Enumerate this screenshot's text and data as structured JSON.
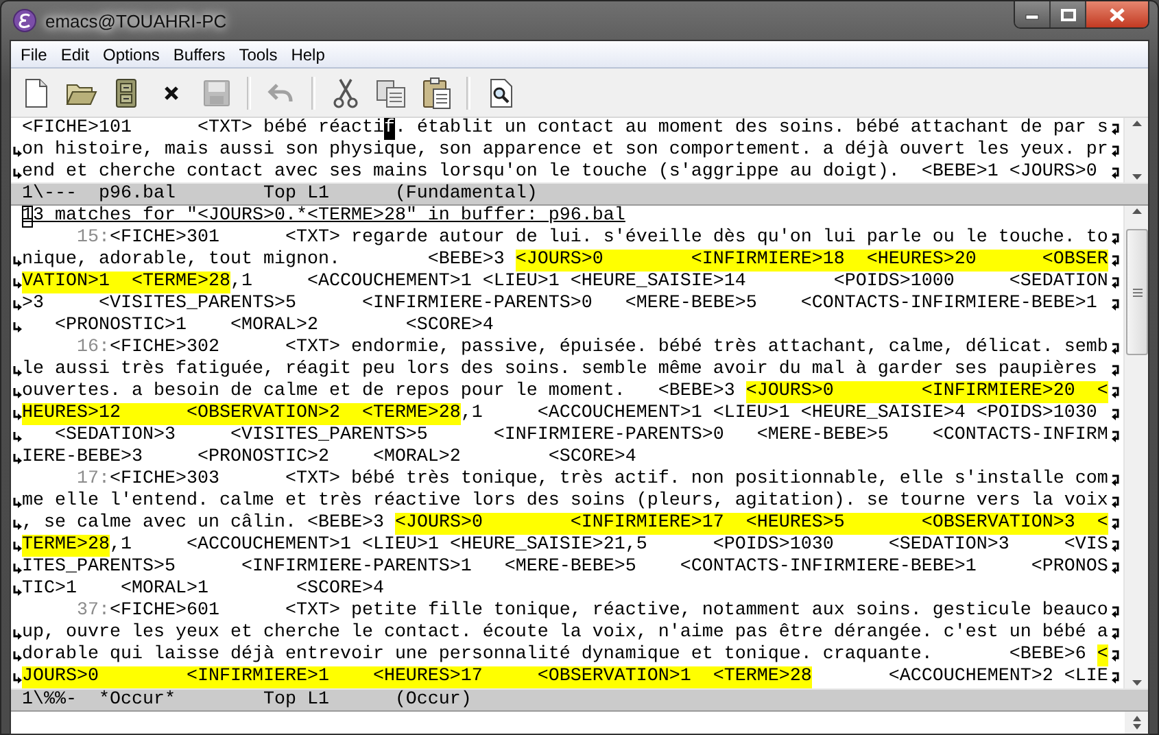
{
  "window": {
    "title": "emacs@TOUAHRI-PC"
  },
  "menu": [
    "File",
    "Edit",
    "Options",
    "Buffers",
    "Tools",
    "Help"
  ],
  "toolbar": [
    {
      "kind": "new",
      "disabled": false
    },
    {
      "kind": "open",
      "disabled": false
    },
    {
      "kind": "dired",
      "disabled": false
    },
    {
      "kind": "kill",
      "disabled": false
    },
    {
      "kind": "save",
      "disabled": true
    },
    {
      "kind": "separator"
    },
    {
      "kind": "undo",
      "disabled": true
    },
    {
      "kind": "separator"
    },
    {
      "kind": "cut",
      "disabled": false
    },
    {
      "kind": "copy",
      "disabled": false
    },
    {
      "kind": "paste",
      "disabled": false
    },
    {
      "kind": "separator"
    },
    {
      "kind": "search",
      "disabled": false
    }
  ],
  "buffers": [
    {
      "lines": [
        {
          "segments": [
            {
              "kind": "text",
              "text": "<FICHE>101      <TXT> bébé réacti"
            },
            {
              "kind": "cursor",
              "text": "f"
            },
            {
              "kind": "text",
              "text": ". établit un contact au moment des soins. bébé attachant de par s"
            }
          ],
          "wrap_start": false,
          "wrap_end": true
        },
        {
          "segments": [
            {
              "kind": "text",
              "text": "on histoire, mais aussi son physique, son apparence et son comportement. a déjà ouvert les yeux. pr"
            }
          ],
          "wrap_start": true,
          "wrap_end": true
        },
        {
          "segments": [
            {
              "kind": "text",
              "text": "end et cherche contact avec ses mains lorsqu'on le touche (s'aggrippe au doigt).  <BEBE>1 <JOURS>0"
            }
          ],
          "wrap_start": true,
          "wrap_end": true
        }
      ],
      "mode_line": "1\\---  p96.bal        Top L1      (Fundamental)"
    },
    {
      "lines": [
        {
          "segments": [
            {
              "kind": "cursor-hollow",
              "text": "1"
            },
            {
              "kind": "header",
              "text": "3 matches for \"<JOURS>0.*<TERME>28\" in buffer: p96.bal"
            }
          ],
          "wrap_start": false,
          "wrap_end": false
        },
        {
          "segments": [
            {
              "kind": "line-number",
              "text": "     15:"
            },
            {
              "kind": "text",
              "text": "<FICHE>301      <TXT> regarde autour de lui. s'éveille dès qu'on lui parle ou le touche. to"
            }
          ],
          "wrap_start": false,
          "wrap_end": true
        },
        {
          "segments": [
            {
              "kind": "text",
              "text": "nique, adorable, tout mignon.        <BEBE>3 "
            },
            {
              "kind": "match",
              "text": "<JOURS>0        <INFIRMIERE>18  <HEURES>20      <OBSER"
            }
          ],
          "wrap_start": true,
          "wrap_end": true
        },
        {
          "segments": [
            {
              "kind": "match",
              "text": "VATION>1  <TERME>28"
            },
            {
              "kind": "text",
              "text": ",1     <ACCOUCHEMENT>1 <LIEU>1 <HEURE_SAISIE>14        <POIDS>1000     <SEDATION"
            }
          ],
          "wrap_start": true,
          "wrap_end": true
        },
        {
          "segments": [
            {
              "kind": "text",
              "text": ">3     <VISITES_PARENTS>5      <INFIRMIERE-PARENTS>0   <MERE-BEBE>5    <CONTACTS-INFIRMIERE-BEBE>1"
            }
          ],
          "wrap_start": true,
          "wrap_end": true
        },
        {
          "segments": [
            {
              "kind": "text",
              "text": "   <PRONOSTIC>1    <MORAL>2        <SCORE>4"
            }
          ],
          "wrap_start": true,
          "wrap_end": false
        },
        {
          "segments": [
            {
              "kind": "line-number",
              "text": "     16:"
            },
            {
              "kind": "text",
              "text": "<FICHE>302      <TXT> endormie, passive, épuisée. bébé très attachant, calme, délicat. semb"
            }
          ],
          "wrap_start": false,
          "wrap_end": true
        },
        {
          "segments": [
            {
              "kind": "text",
              "text": "le aussi très fatiguée, réagit peu lors des soins. semble même avoir du mal à garder ses paupières"
            }
          ],
          "wrap_start": true,
          "wrap_end": true
        },
        {
          "segments": [
            {
              "kind": "text",
              "text": "ouvertes. a besoin de calme et de repos pour le moment.   <BEBE>3 "
            },
            {
              "kind": "match",
              "text": "<JOURS>0        <INFIRMIERE>20  <"
            }
          ],
          "wrap_start": true,
          "wrap_end": true
        },
        {
          "segments": [
            {
              "kind": "match",
              "text": "HEURES>12      <OBSERVATION>2  <TERME>28"
            },
            {
              "kind": "text",
              "text": ",1     <ACCOUCHEMENT>1 <LIEU>1 <HEURE_SAISIE>4 <POIDS>1030"
            }
          ],
          "wrap_start": true,
          "wrap_end": true
        },
        {
          "segments": [
            {
              "kind": "text",
              "text": "   <SEDATION>3     <VISITES_PARENTS>5      <INFIRMIERE-PARENTS>0   <MERE-BEBE>5    <CONTACTS-INFIRM"
            }
          ],
          "wrap_start": true,
          "wrap_end": true
        },
        {
          "segments": [
            {
              "kind": "text",
              "text": "IERE-BEBE>3     <PRONOSTIC>2    <MORAL>2        <SCORE>4"
            }
          ],
          "wrap_start": true,
          "wrap_end": false
        },
        {
          "segments": [
            {
              "kind": "line-number",
              "text": "     17:"
            },
            {
              "kind": "text",
              "text": "<FICHE>303      <TXT> bébé très tonique, très actif. non positionnable, elle s'installe com"
            }
          ],
          "wrap_start": false,
          "wrap_end": true
        },
        {
          "segments": [
            {
              "kind": "text",
              "text": "me elle l'entend. calme et très réactive lors des soins (pleurs, agitation). se tourne vers la voix"
            }
          ],
          "wrap_start": true,
          "wrap_end": true
        },
        {
          "segments": [
            {
              "kind": "text",
              "text": ", se calme avec un câlin. <BEBE>3 "
            },
            {
              "kind": "match",
              "text": "<JOURS>0        <INFIRMIERE>17  <HEURES>5       <OBSERVATION>3  <"
            }
          ],
          "wrap_start": true,
          "wrap_end": true
        },
        {
          "segments": [
            {
              "kind": "match",
              "text": "TERME>28"
            },
            {
              "kind": "text",
              "text": ",1     <ACCOUCHEMENT>1 <LIEU>1 <HEURE_SAISIE>21,5      <POIDS>1030     <SEDATION>3     <VIS"
            }
          ],
          "wrap_start": true,
          "wrap_end": true
        },
        {
          "segments": [
            {
              "kind": "text",
              "text": "ITES_PARENTS>5      <INFIRMIERE-PARENTS>1   <MERE-BEBE>5    <CONTACTS-INFIRMIERE-BEBE>1     <PRONOS"
            }
          ],
          "wrap_start": true,
          "wrap_end": true
        },
        {
          "segments": [
            {
              "kind": "text",
              "text": "TIC>1    <MORAL>1        <SCORE>4"
            }
          ],
          "wrap_start": true,
          "wrap_end": false
        },
        {
          "segments": [
            {
              "kind": "line-number",
              "text": "     37:"
            },
            {
              "kind": "text",
              "text": "<FICHE>601      <TXT> petite fille tonique, réactive, notamment aux soins. gesticule beauco"
            }
          ],
          "wrap_start": false,
          "wrap_end": true
        },
        {
          "segments": [
            {
              "kind": "text",
              "text": "up, ouvre les yeux et cherche le contact. écoute la voix, n'aime pas être dérangée. c'est un bébé a"
            }
          ],
          "wrap_start": true,
          "wrap_end": true
        },
        {
          "segments": [
            {
              "kind": "text",
              "text": "dorable qui laisse déjà entrevoir une personnalité dynamique et tonique. craquante.       <BEBE>6 "
            },
            {
              "kind": "match",
              "text": "<"
            }
          ],
          "wrap_start": true,
          "wrap_end": true
        },
        {
          "segments": [
            {
              "kind": "match",
              "text": "JOURS>0        <INFIRMIERE>1    <HEURES>17     <OBSERVATION>1  <TERME>28"
            },
            {
              "kind": "text",
              "text": "       <ACCOUCHEMENT>2 <LIE"
            }
          ],
          "wrap_start": true,
          "wrap_end": true
        }
      ],
      "mode_line": "1\\%%-  *Occur*        Top L1      (Occur)"
    }
  ]
}
